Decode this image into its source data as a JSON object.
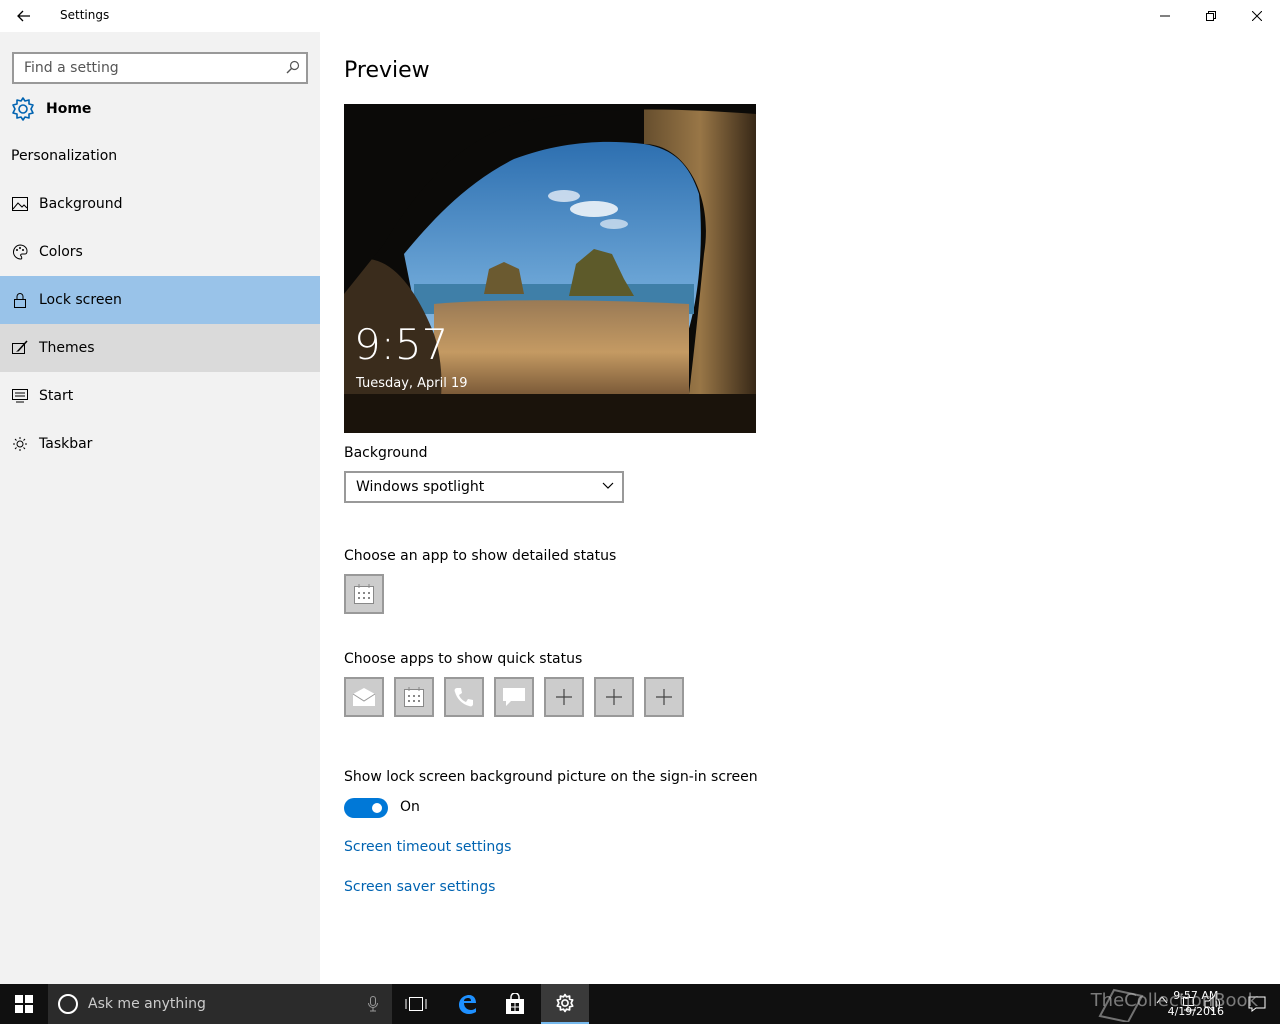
{
  "window": {
    "title": "Settings"
  },
  "sidebar": {
    "search_placeholder": "Find a setting",
    "home_label": "Home",
    "section_title": "Personalization",
    "items": [
      {
        "label": "Background",
        "icon": "image-icon"
      },
      {
        "label": "Colors",
        "icon": "palette-icon"
      },
      {
        "label": "Lock screen",
        "icon": "lock-icon",
        "selected": true
      },
      {
        "label": "Themes",
        "icon": "brush-icon",
        "hover": true
      },
      {
        "label": "Start",
        "icon": "start-menu-icon"
      },
      {
        "label": "Taskbar",
        "icon": "taskbar-icon"
      }
    ]
  },
  "main": {
    "heading": "Preview",
    "preview": {
      "time": "9:57",
      "date": "Tuesday, April 19"
    },
    "background_label": "Background",
    "background_value": "Windows spotlight",
    "detailed_status_label": "Choose an app to show detailed status",
    "quick_status_label": "Choose apps to show quick status",
    "quick_status_apps": [
      "mail-icon",
      "calendar-icon",
      "phone-icon",
      "message-icon",
      "plus-icon",
      "plus-icon",
      "plus-icon"
    ],
    "signin_label": "Show lock screen background picture on the sign-in screen",
    "signin_toggle_state": "On",
    "links": {
      "timeout": "Screen timeout settings",
      "saver": "Screen saver settings"
    }
  },
  "taskbar": {
    "search_text": "Ask me anything",
    "clock_time": "9:57 AM",
    "clock_date": "4/19/2016",
    "watermark": "TheCollectionBook"
  },
  "colors": {
    "accent": "#0078d7",
    "selected_nav": "#99c3e9",
    "link": "#0063b1"
  }
}
